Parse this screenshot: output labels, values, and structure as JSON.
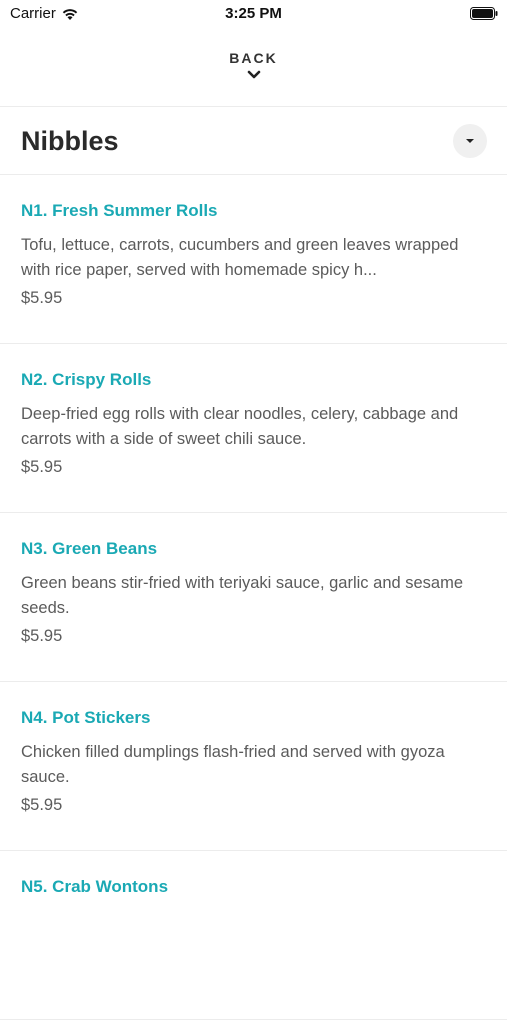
{
  "status_bar": {
    "carrier": "Carrier",
    "time": "3:25 PM",
    "icons": [
      "wifi-icon",
      "battery-icon"
    ]
  },
  "nav": {
    "back_label": "BACK",
    "back_icon": "chevron-down-icon"
  },
  "section": {
    "title": "Nibbles",
    "dropdown_icon": "caret-down-icon"
  },
  "colors": {
    "accent": "#1aa9b4",
    "text": "#2a2a2a",
    "muted": "#5b5b5b"
  },
  "items": [
    {
      "name": "N1. Fresh Summer Rolls",
      "description": "Tofu, lettuce, carrots, cucumbers and green leaves wrapped with rice paper, served with homemade spicy h...",
      "price": "$5.95"
    },
    {
      "name": "N2. Crispy Rolls",
      "description": "Deep-fried egg rolls with clear noodles, celery, cabbage and carrots with a side of sweet chili sauce.",
      "price": "$5.95"
    },
    {
      "name": "N3. Green Beans",
      "description": "Green beans stir-fried with teriyaki sauce, garlic and sesame seeds.",
      "price": "$5.95"
    },
    {
      "name": "N4. Pot Stickers",
      "description": "Chicken filled dumplings flash-fried and served with gyoza sauce.",
      "price": "$5.95"
    },
    {
      "name": "N5. Crab Wontons",
      "description": "",
      "price": ""
    }
  ]
}
